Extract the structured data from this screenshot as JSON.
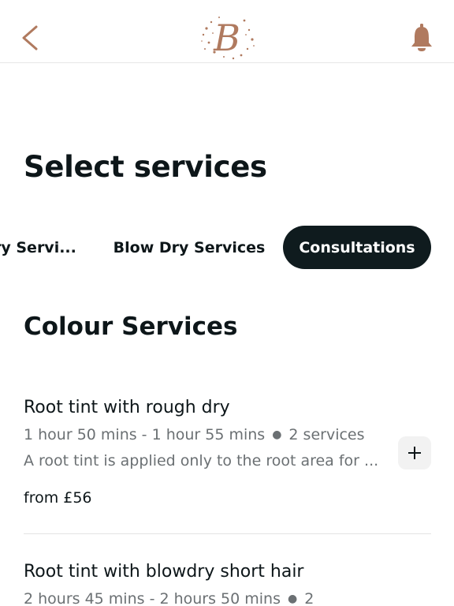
{
  "colors": {
    "accent": "#b07a5f",
    "active_tab_bg": "#0f1b1e",
    "text_primary": "#0d1619",
    "text_secondary": "#6b7073"
  },
  "header": {
    "back_icon": "chevron-left-icon",
    "logo_letter": "B",
    "bell_icon": "bell-icon"
  },
  "page": {
    "title": "Select services"
  },
  "tabs": [
    {
      "label": "ry Servi...",
      "active": false
    },
    {
      "label": "Blow Dry Services",
      "active": false
    },
    {
      "label": "Consultations",
      "active": true
    }
  ],
  "section": {
    "title": "Colour Services"
  },
  "services": [
    {
      "name": "Root tint with rough dry",
      "duration": "1 hour 50 mins - 1 hour 55 mins",
      "count": "2 services",
      "description": "A root tint is applied only to the root area for ...",
      "price": "from £56",
      "add_icon": "plus-icon"
    },
    {
      "name": "Root tint with blowdry short hair",
      "duration": "2 hours 45 mins - 2 hours 50 mins",
      "count": "2"
    }
  ]
}
